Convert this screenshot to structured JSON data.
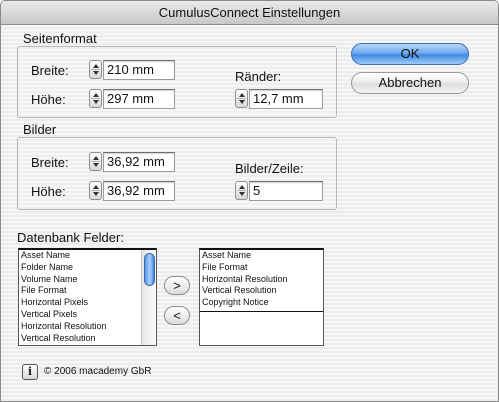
{
  "window": {
    "title": "CumulusConnect Einstellungen"
  },
  "seitenformat": {
    "group_label": "Seitenformat",
    "breite_label": "Breite:",
    "breite_value": "210 mm",
    "hoehe_label": "Höhe:",
    "hoehe_value": "297 mm",
    "raender_label": "Ränder:",
    "raender_value": "12,7 mm"
  },
  "bilder": {
    "group_label": "Bilder",
    "breite_label": "Breite:",
    "breite_value": "36,92 mm",
    "hoehe_label": "Höhe:",
    "hoehe_value": "36,92 mm",
    "bilder_zeile_label": "Bilder/Zeile:",
    "bilder_zeile_value": "5"
  },
  "buttons": {
    "ok": "OK",
    "cancel": "Abbrechen",
    "add": ">",
    "remove": "<"
  },
  "datenbank": {
    "label": "Datenbank Felder:",
    "available": [
      "Asset Name",
      "Folder Name",
      "Volume Name",
      "File Format",
      "Horizontal Pixels",
      "Vertical Pixels",
      "Horizontal Resolution",
      "Vertical Resolution"
    ],
    "selected": [
      "Asset Name",
      "File Format",
      "Horizontal Resolution",
      "Vertical Resolution",
      "Copyright Notice"
    ]
  },
  "footer": {
    "info_icon": "i",
    "copyright": "© 2006 macademy GbR"
  },
  "colors": {
    "default_button": "#6ea9ec",
    "scroll_thumb": "#5b9ae6"
  }
}
